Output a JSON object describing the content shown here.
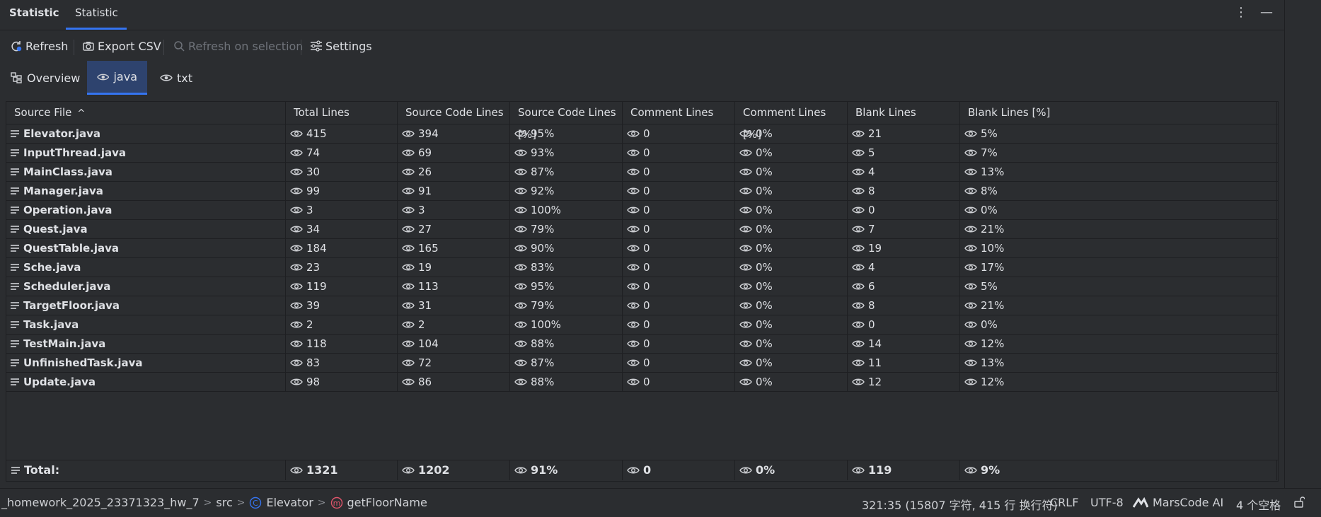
{
  "header": {
    "tab_main": "Statistic",
    "tab_selected": "Statistic",
    "more_icon": "more-vertical-icon",
    "minimize_icon": "minimize-icon"
  },
  "toolbar": {
    "refresh": "Refresh",
    "export_csv": "Export CSV",
    "refresh_on_selection": "Refresh on selection",
    "settings": "Settings"
  },
  "view_tabs": {
    "overview": "Overview",
    "java": "java",
    "txt": "txt"
  },
  "table": {
    "columns": [
      "Source File",
      "Total Lines",
      "Source Code Lines",
      "Source Code Lines [%]",
      "Comment Lines",
      "Comment Lines [%]",
      "Blank Lines",
      "Blank Lines [%]"
    ],
    "sort_indicator": "^",
    "rows": [
      [
        "Elevator.java",
        "415",
        "394",
        "95%",
        "0",
        "0%",
        "21",
        "5%"
      ],
      [
        "InputThread.java",
        "74",
        "69",
        "93%",
        "0",
        "0%",
        "5",
        "7%"
      ],
      [
        "MainClass.java",
        "30",
        "26",
        "87%",
        "0",
        "0%",
        "4",
        "13%"
      ],
      [
        "Manager.java",
        "99",
        "91",
        "92%",
        "0",
        "0%",
        "8",
        "8%"
      ],
      [
        "Operation.java",
        "3",
        "3",
        "100%",
        "0",
        "0%",
        "0",
        "0%"
      ],
      [
        "Quest.java",
        "34",
        "27",
        "79%",
        "0",
        "0%",
        "7",
        "21%"
      ],
      [
        "QuestTable.java",
        "184",
        "165",
        "90%",
        "0",
        "0%",
        "19",
        "10%"
      ],
      [
        "Sche.java",
        "23",
        "19",
        "83%",
        "0",
        "0%",
        "4",
        "17%"
      ],
      [
        "Scheduler.java",
        "119",
        "113",
        "95%",
        "0",
        "0%",
        "6",
        "5%"
      ],
      [
        "TargetFloor.java",
        "39",
        "31",
        "79%",
        "0",
        "0%",
        "8",
        "21%"
      ],
      [
        "Task.java",
        "2",
        "2",
        "100%",
        "0",
        "0%",
        "0",
        "0%"
      ],
      [
        "TestMain.java",
        "118",
        "104",
        "88%",
        "0",
        "0%",
        "14",
        "12%"
      ],
      [
        "UnfinishedTask.java",
        "83",
        "72",
        "87%",
        "0",
        "0%",
        "11",
        "13%"
      ],
      [
        "Update.java",
        "98",
        "86",
        "88%",
        "0",
        "0%",
        "12",
        "12%"
      ]
    ],
    "total": [
      "Total:",
      "1321",
      "1202",
      "91%",
      "0",
      "0%",
      "119",
      "9%"
    ]
  },
  "status": {
    "project": "_homework_2025_23371323_hw_7",
    "src": "src",
    "class": "Elevator",
    "method": "getFloorName",
    "position": "321:35 (15807 字符, 415 行 换行符)",
    "line_sep": "CRLF",
    "encoding": "UTF-8",
    "ai": "MarsCode AI",
    "indent": "4 个空格"
  },
  "colors": {
    "accent": "#3574f0",
    "background": "#2b2d30",
    "selected_tab": "#2e436e",
    "class_icon": "#3574f0",
    "method_icon": "#e0556b"
  }
}
